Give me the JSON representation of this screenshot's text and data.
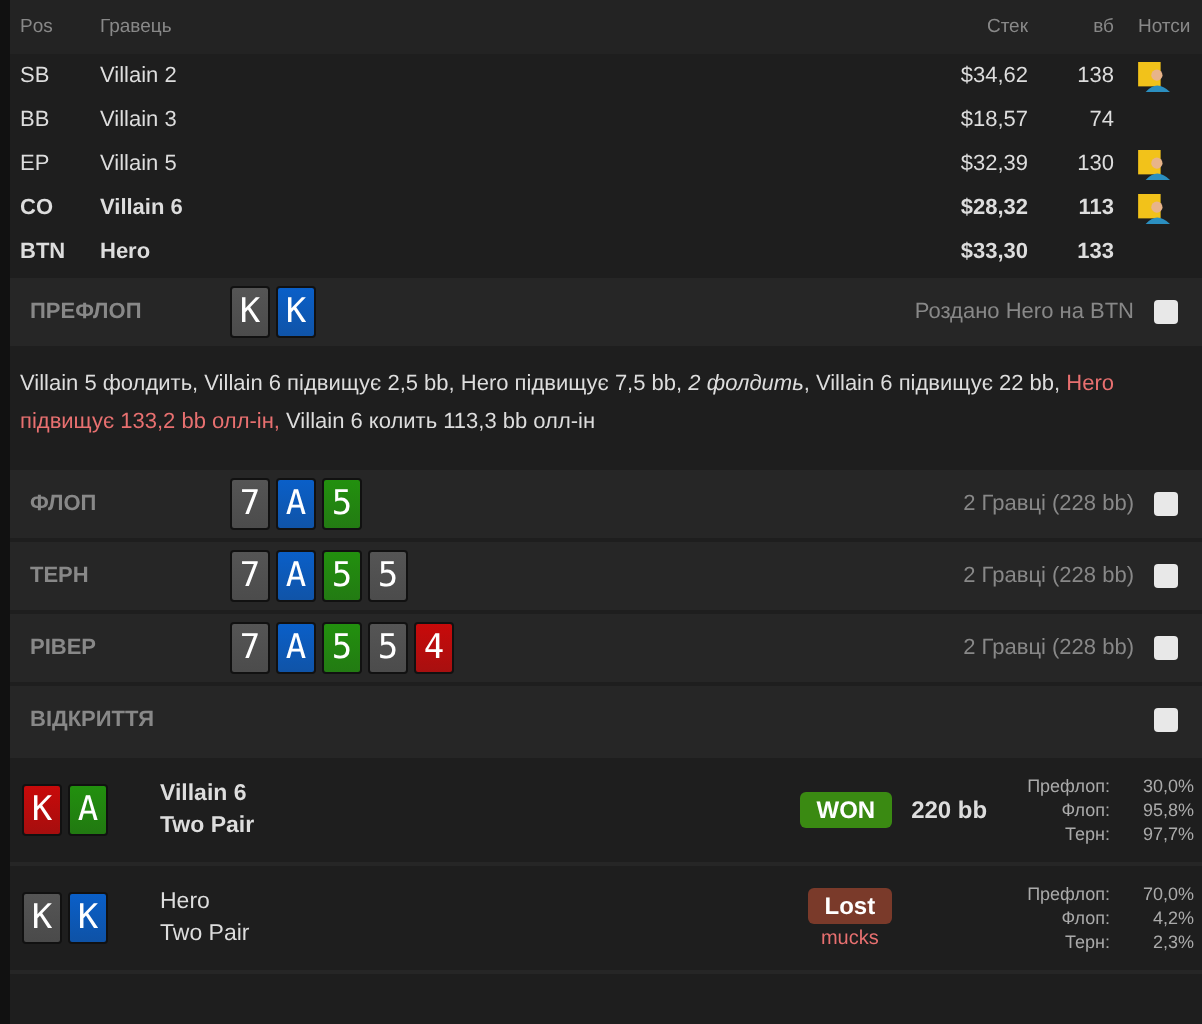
{
  "players": {
    "columns": [
      "Pos",
      "Гравець",
      "Стек",
      "вб",
      "Нотси"
    ],
    "rows": [
      {
        "pos": "SB",
        "name": "Villain 2",
        "stack": "$34,62",
        "bb": "138",
        "in_hand": false,
        "note": true
      },
      {
        "pos": "BB",
        "name": "Villain 3",
        "stack": "$18,57",
        "bb": "74",
        "in_hand": false,
        "note": false
      },
      {
        "pos": "EP",
        "name": "Villain 5",
        "stack": "$32,39",
        "bb": "130",
        "in_hand": false,
        "note": true
      },
      {
        "pos": "CO",
        "name": "Villain 6",
        "stack": "$28,32",
        "bb": "113",
        "in_hand": true,
        "note": true
      },
      {
        "pos": "BTN",
        "name": "Hero",
        "stack": "$33,30",
        "bb": "133",
        "in_hand": true,
        "note": false
      }
    ]
  },
  "streets": [
    {
      "label": "ПРЕФЛОП",
      "cards": [
        {
          "rank": "K",
          "color": "#555555"
        },
        {
          "rank": "K",
          "color": "#0a5fc8"
        }
      ],
      "summary": "Роздано Hero на BTN",
      "checked": false,
      "actions": [
        {
          "kind": "plain",
          "text": "Villain 5 фолдить, Villain 6 підвищує 2,5 bb, Hero підвищує 7,5 bb, "
        },
        {
          "kind": "fold",
          "text": "2 фолдить"
        },
        {
          "kind": "plain",
          "text": ", Villain 6 підвищує 22 bb, "
        },
        {
          "kind": "hero",
          "text": "Hero підвищує 133,2 bb олл-ін,"
        },
        {
          "kind": "plain",
          "text": " Villain 6 колить 113,3 bb олл-ін"
        }
      ]
    },
    {
      "label": "ФЛОП",
      "cards": [
        {
          "rank": "7",
          "color": "#555555"
        },
        {
          "rank": "A",
          "color": "#0a5fc8"
        },
        {
          "rank": "5",
          "color": "#22900e"
        }
      ],
      "summary": "2 Гравці (228 bb)",
      "checked": false
    },
    {
      "label": "ТЕРН",
      "cards": [
        {
          "rank": "7",
          "color": "#555555"
        },
        {
          "rank": "A",
          "color": "#0a5fc8"
        },
        {
          "rank": "5",
          "color": "#22900e"
        },
        {
          "rank": "5",
          "color": "#555555"
        }
      ],
      "summary": "2 Гравці (228 bb)",
      "checked": false
    },
    {
      "label": "РІВЕР",
      "cards": [
        {
          "rank": "7",
          "color": "#555555"
        },
        {
          "rank": "A",
          "color": "#0a5fc8"
        },
        {
          "rank": "5",
          "color": "#22900e"
        },
        {
          "rank": "5",
          "color": "#555555"
        },
        {
          "rank": "4",
          "color": "#c80a0a"
        }
      ],
      "summary": "2 Гравці (228 bb)",
      "checked": false
    },
    {
      "label": "ВІДКРИТТЯ",
      "checked": false
    }
  ],
  "results": [
    {
      "cards": [
        {
          "rank": "K",
          "color": "#c80a0a"
        },
        {
          "rank": "A",
          "color": "#22900e"
        }
      ],
      "name": "Villain 6",
      "hand": "Two Pair",
      "winner": true,
      "result": {
        "kind": "won",
        "label": "WON"
      },
      "amount": "220 bb",
      "equity": [
        {
          "label": "Префлоп:",
          "value": "30,0%"
        },
        {
          "label": "Флоп:",
          "value": "95,8%"
        },
        {
          "label": "Терн:",
          "value": "97,7%"
        }
      ]
    },
    {
      "cards": [
        {
          "rank": "K",
          "color": "#555555"
        },
        {
          "rank": "K",
          "color": "#0a5fc8"
        }
      ],
      "name": "Hero",
      "hand": "Two Pair",
      "winner": false,
      "result": {
        "kind": "lost",
        "label": "Lost"
      },
      "note": "mucks",
      "equity": [
        {
          "label": "Префлоп:",
          "value": "70,0%"
        },
        {
          "label": "Флоп:",
          "value": "4,2%"
        },
        {
          "label": "Терн:",
          "value": "2,3%"
        }
      ]
    }
  ]
}
